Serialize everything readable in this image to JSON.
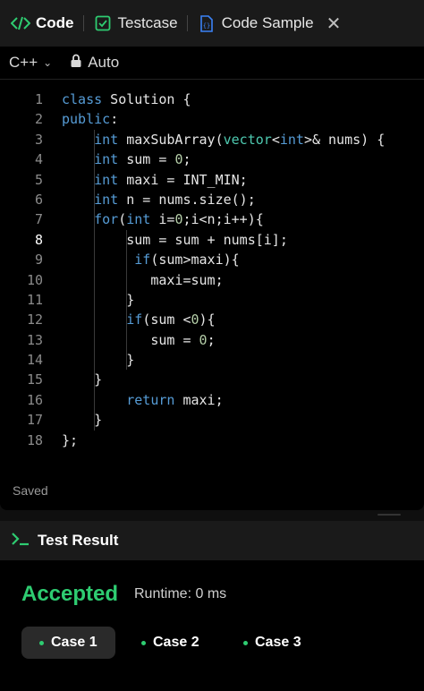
{
  "colors": {
    "accent_green": "#2ecc71",
    "keyword_blue": "#569cd6",
    "text": "#e6e6e6"
  },
  "tabs": [
    {
      "label": "Code",
      "icon": "code-icon",
      "active": true
    },
    {
      "label": "Testcase",
      "icon": "checkbox-icon",
      "active": false
    },
    {
      "label": "Code Sample",
      "icon": "file-code-icon",
      "active": false
    }
  ],
  "toolbar": {
    "language": "C++",
    "mode": "Auto"
  },
  "code_lines": [
    "class Solution {",
    "public:",
    "    int maxSubArray(vector<int>& nums) {",
    "    int sum = 0;",
    "    int maxi = INT_MIN;",
    "    int n = nums.size();",
    "    for(int i=0;i<n;i++){",
    "        sum = sum + nums[i];",
    "         if(sum>maxi){",
    "           maxi=sum;",
    "        }",
    "        if(sum <0){",
    "           sum = 0;",
    "        }",
    "    }",
    "        return maxi;",
    "    }",
    "};"
  ],
  "line_numbers": [
    "1",
    "2",
    "3",
    "4",
    "5",
    "6",
    "7",
    "8",
    "9",
    "10",
    "11",
    "12",
    "13",
    "14",
    "15",
    "16",
    "17",
    "18"
  ],
  "status": "Saved",
  "result": {
    "title": "Test Result",
    "verdict": "Accepted",
    "runtime": "Runtime: 0 ms",
    "cases": [
      "Case 1",
      "Case 2",
      "Case 3"
    ]
  }
}
